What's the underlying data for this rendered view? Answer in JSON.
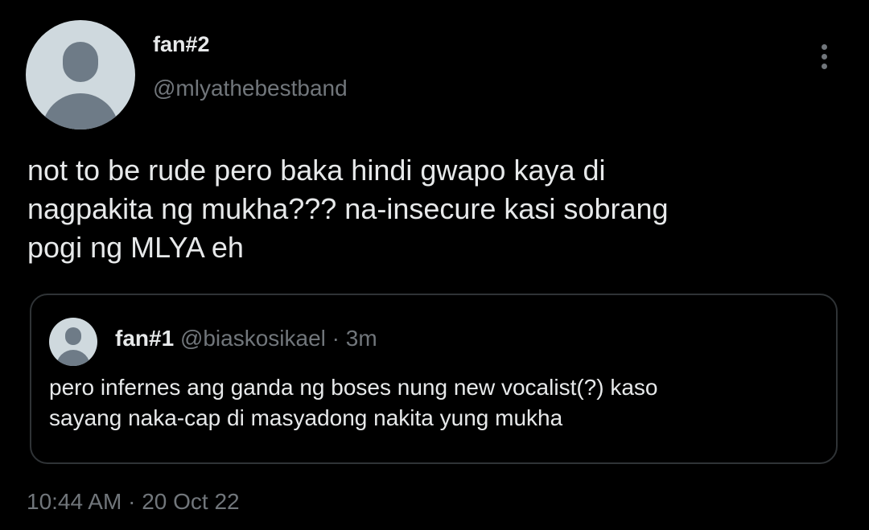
{
  "tweet": {
    "author": {
      "display_name": "fan#2",
      "handle": "@mlyathebestband",
      "avatar_icon": "default-avatar-icon"
    },
    "more_icon": "more-vertical-icon",
    "text": "not to be rude pero baka hindi gwapo kaya di\nnagpakita ng mukha??? na-insecure kasi sobrang\npogi ng MLYA eh",
    "time": "10:44 AM",
    "separator": "·",
    "date": "20 Oct 22"
  },
  "quoted_tweet": {
    "display_name": "fan#1",
    "handle": "@biaskosikael",
    "separator": "·",
    "time_ago": "3m",
    "text": "pero infernes ang ganda ng boses nung new vocalist(?) kaso\nsayang naka-cap di masyadong nakita yung mukha",
    "avatar_icon": "default-avatar-icon"
  },
  "colors": {
    "background": "#000000",
    "primary_text": "#e7e9ea",
    "secondary_text": "#71767b",
    "border": "#2f3336",
    "avatar_bg": "#cfd9de",
    "avatar_fg": "#6e7b87"
  }
}
